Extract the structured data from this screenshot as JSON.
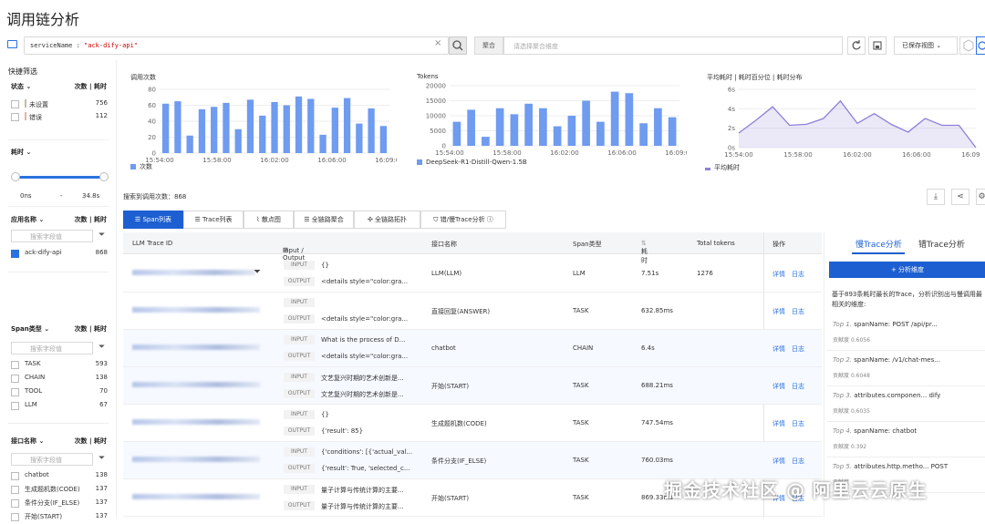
{
  "page_title": "调用链分析",
  "search": {
    "key": "serviceName",
    "sep": " : ",
    "value": "\"ack-dify-api\"",
    "agg_label": "聚合",
    "agg_placeholder": "请选择聚合维度",
    "saved_views": "已保存视图"
  },
  "sidebar": {
    "title": "快捷筛选",
    "status_head": "状态",
    "count_label": "次数 | 耗时",
    "status_items": [
      {
        "label": "未设置",
        "count": "756",
        "color": "#c7b8a6"
      },
      {
        "label": "错误",
        "count": "112",
        "color": "#e8b3a8"
      }
    ],
    "latency_head": "耗时",
    "latency_min": "0ns",
    "latency_dash": "-",
    "latency_max": "34.8s",
    "app_head": "应用名称",
    "search_placeholder": "搜索字段值",
    "app_items": [
      {
        "label": "ack-dify-api",
        "count": "868",
        "checked": true
      }
    ],
    "span_head": "Span类型",
    "span_items": [
      {
        "label": "TASK",
        "count": "593"
      },
      {
        "label": "CHAIN",
        "count": "138"
      },
      {
        "label": "TOOL",
        "count": "70"
      },
      {
        "label": "LLM",
        "count": "67"
      }
    ],
    "iface_head": "接口名称",
    "iface_items": [
      {
        "label": "chatbot",
        "count": "138"
      },
      {
        "label": "生成题机数(CODE)",
        "count": "137"
      },
      {
        "label": "条件分支(IF_ELSE)",
        "count": "137"
      },
      {
        "label": "开始(START)",
        "count": "137"
      }
    ]
  },
  "charts_text": {
    "calls_title": "调用次数",
    "calls_legend": "次数",
    "tokens_title": "Tokens",
    "tokens_legend": "DeepSeek-R1-Distill-Qwen-1.5B",
    "latency_title": "平均耗时 | 耗时百分位 | 耗时分布",
    "latency_legend": "平均耗时"
  },
  "chart_data": [
    {
      "type": "bar",
      "title": "调用次数",
      "series": [
        {
          "name": "次数",
          "values": [
            62,
            65,
            22,
            55,
            58,
            63,
            30,
            67,
            47,
            64,
            60,
            71,
            68,
            23,
            57,
            69,
            37,
            56,
            34
          ]
        }
      ],
      "yticks": [
        "0",
        "20",
        "40",
        "60",
        "80"
      ],
      "ylim": [
        0,
        80
      ],
      "xticks": [
        "15:54:00",
        "15:58:00",
        "16:02:00",
        "16:06:00",
        "16:09:00"
      ],
      "color": "#6f9bf0"
    },
    {
      "type": "bar",
      "title": "Tokens",
      "series": [
        {
          "name": "DeepSeek-R1-Distill-Qwen-1.5B",
          "values": [
            8000,
            12000,
            3000,
            12500,
            10500,
            14000,
            12500,
            6500,
            10000,
            15000,
            8000,
            18000,
            17500,
            7500,
            12500,
            9500
          ]
        }
      ],
      "yticks": [
        "0",
        "5000",
        "10000",
        "15000",
        "20000"
      ],
      "ylim": [
        0,
        20000
      ],
      "xticks": [
        "15:54:00",
        "15:58:00",
        "16:02:00",
        "16:06:00",
        "16:09:00"
      ],
      "color": "#6f9bf0"
    },
    {
      "type": "area",
      "title": "平均耗时",
      "series": [
        {
          "name": "平均耗时",
          "values": [
            1.5,
            2.8,
            4.2,
            2.3,
            2.4,
            3.0,
            4.8,
            2.5,
            3.5,
            2.4,
            1.6,
            3.0,
            2.3,
            2.3,
            0
          ]
        }
      ],
      "yticks": [
        "0s",
        "2s",
        "4s",
        "6s"
      ],
      "ylim": [
        0,
        6
      ],
      "xticks": [
        "15:54:00",
        "15:58:00",
        "16:02:00",
        "16:06:00",
        "16:09:00"
      ],
      "color": "#8f7fd8"
    }
  ],
  "results": {
    "count_text": "搜索到调用次数：868",
    "tabs": [
      "Span列表",
      "Trace列表",
      "散点图",
      "全链路聚合",
      "全链路拓扑",
      "错/慢Trace分析 ⓘ"
    ],
    "headers": [
      "LLM Trace ID",
      "Input / Output",
      "接口名称",
      "Span类型",
      "耗时",
      "Total tokens",
      "操作"
    ],
    "sort_icon": "⇅",
    "input_tag": "INPUT",
    "output_tag": "OUTPUT",
    "detail": "详情",
    "log": "日志",
    "rows": [
      {
        "input": "{}",
        "output": "<details style=\"color:gra...",
        "name": "LLM(LLM)",
        "type": "LLM",
        "dur": "7.51s",
        "tokens": "1276"
      },
      {
        "input": "",
        "output": "<details style=\"color:gra...",
        "name": "直接回复(ANSWER)",
        "type": "TASK",
        "dur": "632.85ms",
        "tokens": ""
      },
      {
        "input": "What is the process of D...",
        "output": "<details style=\"color:gra...",
        "name": "chatbot",
        "type": "CHAIN",
        "dur": "6.4s",
        "tokens": ""
      },
      {
        "input": "文艺复兴时期的艺术创新是...",
        "output": "文艺复兴时期的艺术创新是...",
        "name": "开始(START)",
        "type": "TASK",
        "dur": "688.21ms",
        "tokens": ""
      },
      {
        "input": "{}",
        "output": "{'result': 85}",
        "name": "生成题机数(CODE)",
        "type": "TASK",
        "dur": "747.54ms",
        "tokens": ""
      },
      {
        "input": "{'conditions': [{'actual_val...",
        "output": "{'result': True, 'selected_c...",
        "name": "条件分支(IF_ELSE)",
        "type": "TASK",
        "dur": "760.03ms",
        "tokens": ""
      },
      {
        "input": "量子计算与传统计算的主要...",
        "output": "量子计算与传统计算的主要...",
        "name": "开始(START)",
        "type": "TASK",
        "dur": "869.33ms",
        "tokens": ""
      }
    ]
  },
  "right_panel": {
    "tab_slow": "慢Trace分析",
    "tab_error": "错Trace分析",
    "button": "+ 分析维度",
    "desc": "基于893条耗时最长的Trace，分析识别出与慢调用最相关的维度:",
    "score_label": "贡献度",
    "items": [
      {
        "rank": "Top 1.",
        "text": "spanName: POST /api/pr...",
        "score": "0.6056"
      },
      {
        "rank": "Top 2.",
        "text": "spanName: /v1/chat-mes...",
        "score": "0.6048"
      },
      {
        "rank": "Top 3.",
        "text": "attributes.componen... dify",
        "score": "0.6035"
      },
      {
        "rank": "Top 4.",
        "text": "spanName: chatbot",
        "score": "0.392"
      },
      {
        "rank": "Top 5.",
        "text": "attributes.http.metho... POST",
        "score": ""
      }
    ]
  },
  "watermark": "掘金技术社区 @ 阿里云云原生"
}
